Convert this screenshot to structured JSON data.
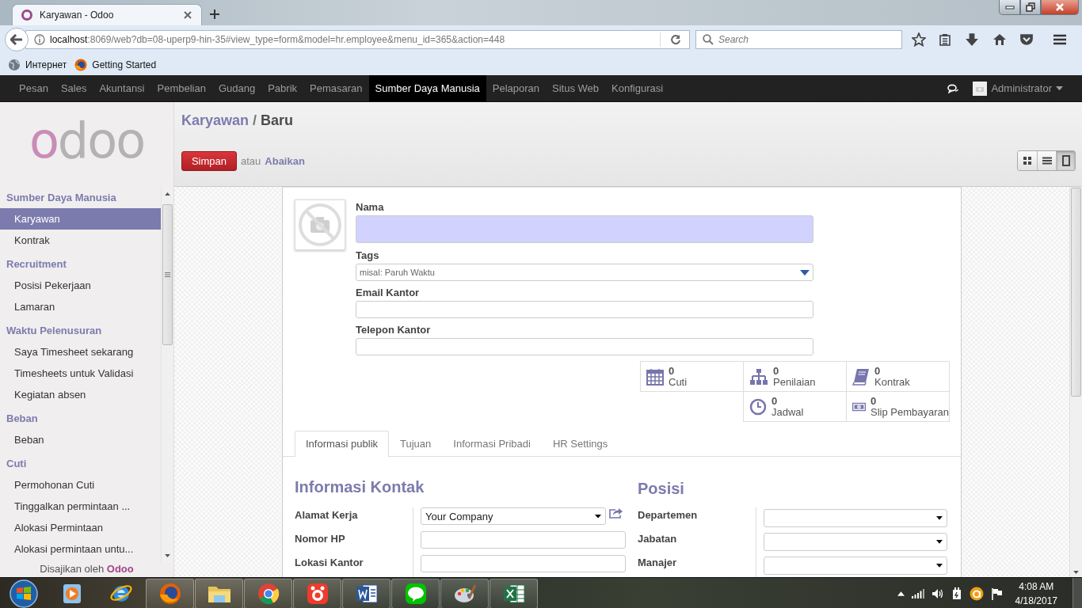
{
  "browser": {
    "tab_title": "Karyawan - Odoo",
    "url_host": "localhost",
    "url_rest": ":8069/web?db=08-uperp9-hin-35#view_type=form&model=hr.employee&menu_id=365&action=448",
    "search_placeholder": "Search",
    "bookmarks": [
      {
        "kind": "globe",
        "label": "Интернет"
      },
      {
        "kind": "firefox",
        "label": "Getting Started"
      }
    ]
  },
  "top_menu": {
    "items": [
      {
        "label": "Pesan",
        "selected": false
      },
      {
        "label": "Sales",
        "selected": false
      },
      {
        "label": "Akuntansi",
        "selected": false
      },
      {
        "label": "Pembelian",
        "selected": false
      },
      {
        "label": "Gudang",
        "selected": false
      },
      {
        "label": "Pabrik",
        "selected": false
      },
      {
        "label": "Pemasaran",
        "selected": false
      },
      {
        "label": "Sumber Daya Manusia",
        "selected": true
      },
      {
        "label": "Pelaporan",
        "selected": false
      },
      {
        "label": "Situs Web",
        "selected": false
      },
      {
        "label": "Konfigurasi",
        "selected": false
      }
    ],
    "user": "Administrator"
  },
  "sidebar": {
    "logo": "odoo",
    "sections": [
      {
        "title": "Sumber Daya Manusia",
        "items": [
          {
            "label": "Karyawan",
            "selected": true
          },
          {
            "label": "Kontrak",
            "selected": false
          }
        ]
      },
      {
        "title": "Recruitment",
        "items": [
          {
            "label": "Posisi Pekerjaan",
            "selected": false
          },
          {
            "label": "Lamaran",
            "selected": false
          }
        ]
      },
      {
        "title": "Waktu Pelenusuran",
        "items": [
          {
            "label": "Saya Timesheet sekarang",
            "selected": false
          },
          {
            "label": "Timesheets untuk Validasi",
            "selected": false
          },
          {
            "label": "Kegiatan absen",
            "selected": false
          }
        ]
      },
      {
        "title": "Beban",
        "items": [
          {
            "label": "Beban",
            "selected": false
          }
        ]
      },
      {
        "title": "Cuti",
        "items": [
          {
            "label": "Permohonan Cuti",
            "selected": false
          },
          {
            "label": "Tinggalkan permintaan ...",
            "selected": false
          },
          {
            "label": "Alokasi Permintaan",
            "selected": false
          },
          {
            "label": "Alokasi permintaan untu...",
            "selected": false
          }
        ]
      }
    ],
    "footer": {
      "text": "Disajikan oleh",
      "link": "Odoo"
    }
  },
  "control_panel": {
    "breadcrumb": [
      "Karyawan",
      "Baru"
    ],
    "separator": "/",
    "save": "Simpan",
    "or": "atau",
    "discard": "Abaikan",
    "views": [
      {
        "kind": "kanban",
        "selected": false
      },
      {
        "kind": "list",
        "selected": false
      },
      {
        "kind": "form",
        "selected": true
      }
    ]
  },
  "form": {
    "name": {
      "label": "Nama",
      "required": true
    },
    "tags": {
      "label": "Tags",
      "placeholder": "misal: Paruh Waktu"
    },
    "email": {
      "label": "Email Kantor",
      "required": false
    },
    "phone": {
      "label": "Telepon Kantor",
      "required": false
    },
    "smart_buttons": [
      {
        "kind": "calendar",
        "count": "0",
        "label": "Cuti"
      },
      {
        "kind": "orgchart",
        "count": "0",
        "label": "Penilaian"
      },
      {
        "kind": "book",
        "count": "0",
        "label": "Kontrak"
      },
      {
        "kind": "clock",
        "count": "0",
        "label": "Jadwal"
      },
      {
        "kind": "money",
        "count": "0",
        "label": "Slip Pembayaran"
      }
    ],
    "tabs": [
      {
        "label": "Informasi publik",
        "selected": true
      },
      {
        "label": "Tujuan",
        "selected": false
      },
      {
        "label": "Informasi Pribadi",
        "selected": false
      },
      {
        "label": "HR Settings",
        "selected": false
      }
    ],
    "groups": [
      {
        "title": "Informasi Kontak",
        "fields": [
          {
            "label": "Alamat Kerja",
            "kind": "select",
            "value": "Your Company",
            "link": true
          },
          {
            "label": "Nomor HP",
            "kind": "text"
          },
          {
            "label": "Lokasi Kantor",
            "kind": "text"
          }
        ]
      },
      {
        "title": "Posisi",
        "fields": [
          {
            "label": "Departemen",
            "kind": "select",
            "link": false
          },
          {
            "label": "Jabatan",
            "kind": "select",
            "link": false
          },
          {
            "label": "Manajer",
            "kind": "select",
            "link": false
          }
        ]
      }
    ]
  },
  "taskbar": {
    "apps": [
      {
        "kind": "media",
        "running": false
      },
      {
        "kind": "ie",
        "running": false
      },
      {
        "kind": "firefox",
        "running": true
      },
      {
        "kind": "folder",
        "running": true
      },
      {
        "kind": "chrome",
        "running": true
      },
      {
        "kind": "capture",
        "running": true
      },
      {
        "kind": "word",
        "running": true
      },
      {
        "kind": "chat",
        "running": true
      },
      {
        "kind": "paint",
        "running": true
      },
      {
        "kind": "excel",
        "running": true
      }
    ],
    "clock": {
      "time": "4:08 AM",
      "date": "4/18/2017"
    }
  }
}
